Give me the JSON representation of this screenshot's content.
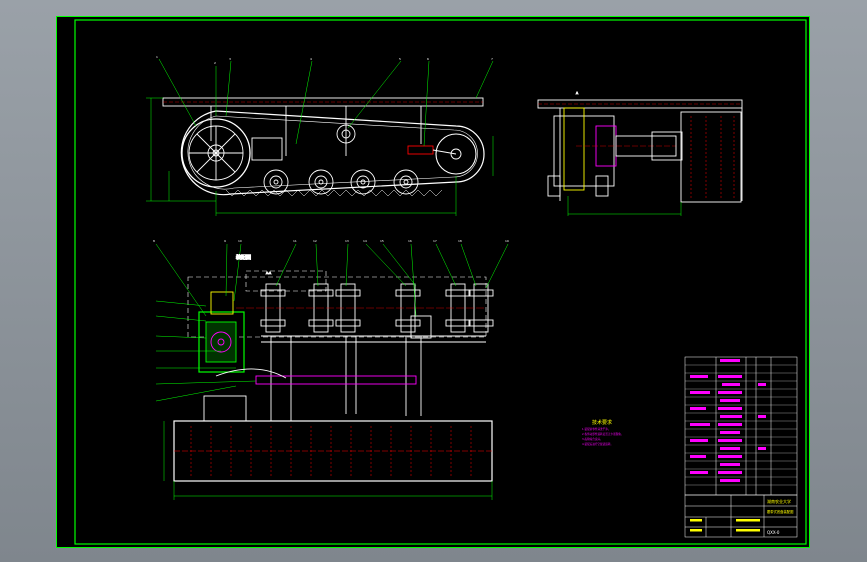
{
  "drawing": {
    "section_label": "A-A",
    "section_label_top": "A",
    "notes_title": "技术要求",
    "notes": [
      "1.装配前零件清洗干净。",
      "2.各传动部件运转灵活无卡滞现象。",
      "3.齿轮啮合良好。",
      "4.装配后进行空载试运转。"
    ],
    "assembly_title": "装配图",
    "title_block": {
      "school": "湖南农业大学",
      "drawing_name": "履带式底盘装配图",
      "drawing_no": "QXX-0"
    }
  },
  "colors": {
    "frame": "#00ff00",
    "lines": "#ffffff",
    "hatch": "#ff0000",
    "accent": "#00ffff",
    "text_yellow": "#ffff00",
    "text_magenta": "#ff00ff"
  }
}
